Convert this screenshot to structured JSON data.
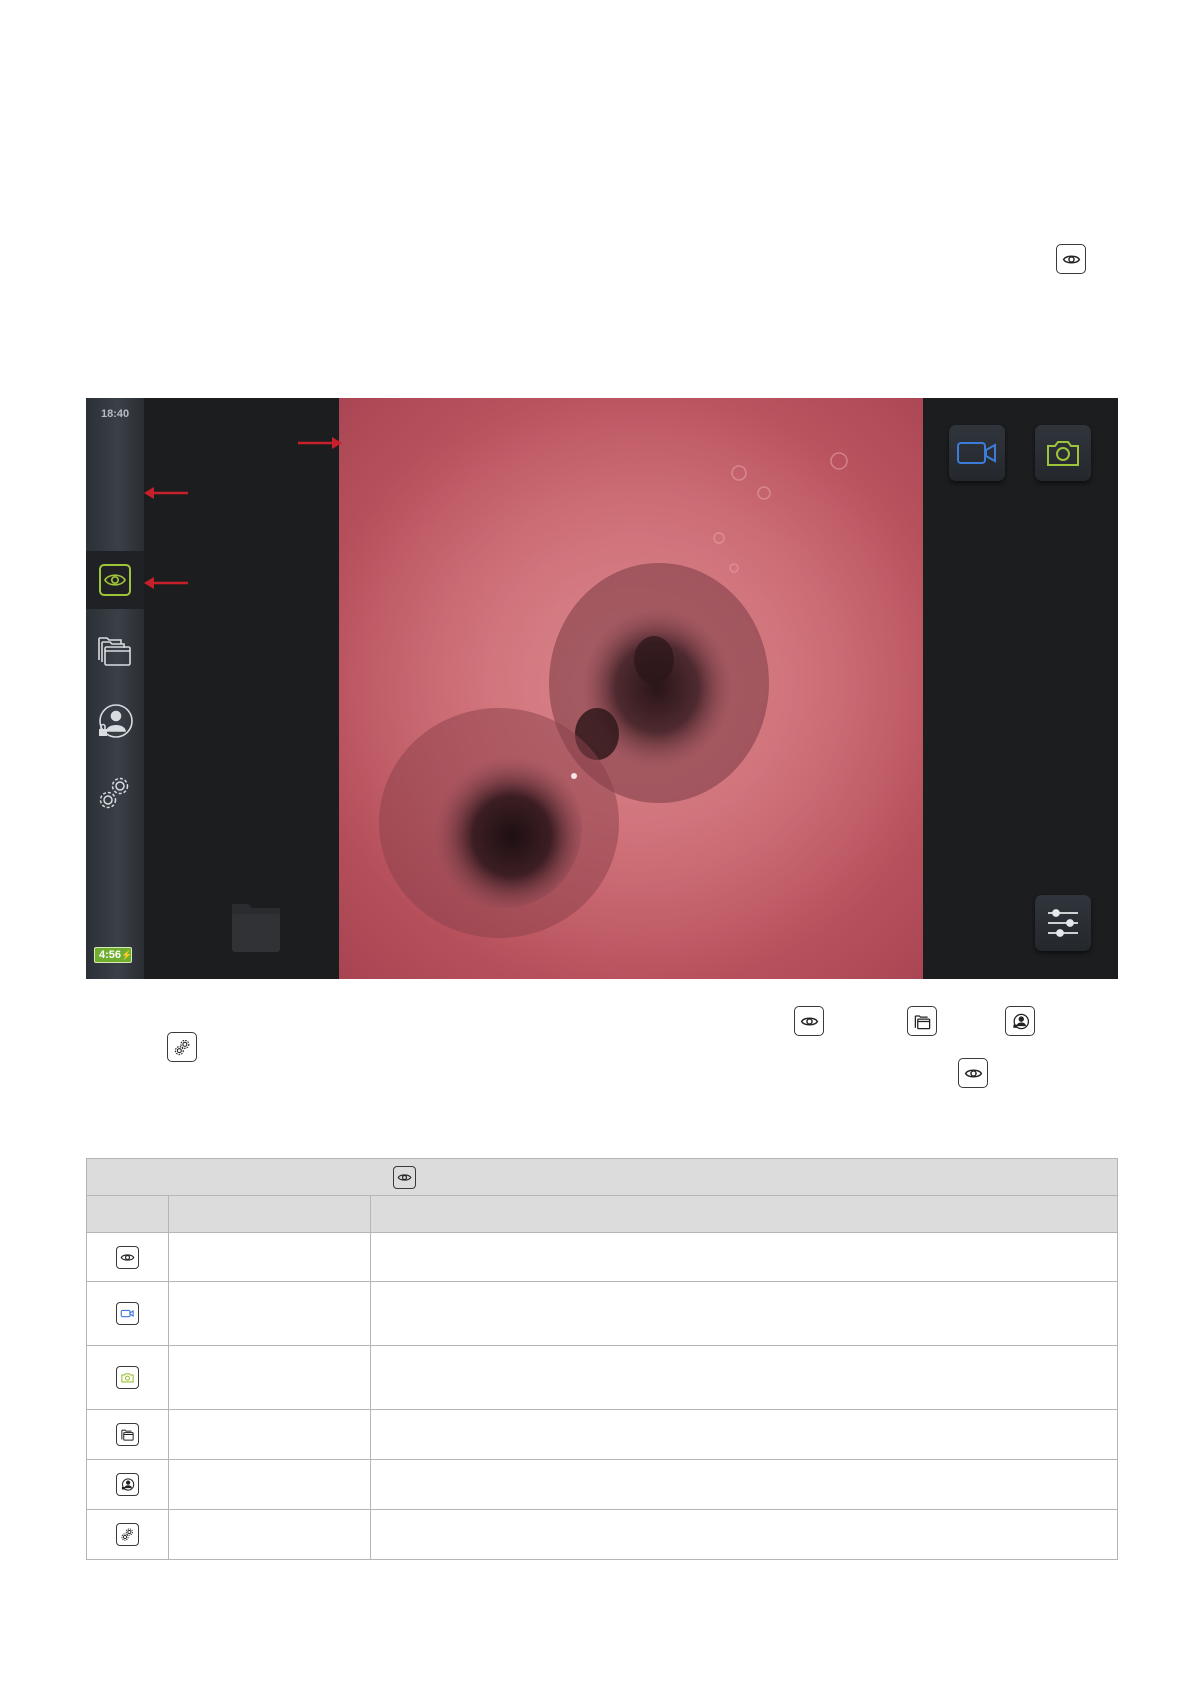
{
  "figure": {
    "clock": "18:40",
    "battery": "4:56",
    "nav_items": [
      "eye-icon",
      "folders-icon",
      "user-lock-icon",
      "gears-icon"
    ],
    "right_buttons": [
      "record-video-icon",
      "capture-image-icon",
      "adjust-sliders-icon"
    ],
    "colors": {
      "accent_green": "#9ec43a",
      "record_blue": "#3d7bd8",
      "arrow_red": "#c8202a"
    }
  },
  "table": {
    "header_icon": "eye-icon",
    "rows": [
      {
        "icon": "eye-icon"
      },
      {
        "icon": "record-video-icon"
      },
      {
        "icon": "capture-image-icon"
      },
      {
        "icon": "folders-icon"
      },
      {
        "icon": "user-lock-icon"
      },
      {
        "icon": "gears-icon"
      }
    ]
  }
}
